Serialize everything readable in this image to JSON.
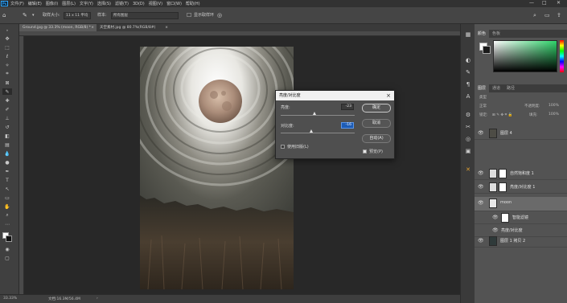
{
  "app": {
    "logo": "Ps"
  },
  "menubar": {
    "items": [
      "文件(F)",
      "编辑(E)",
      "图像(I)",
      "图层(L)",
      "文字(Y)",
      "选择(S)",
      "滤镜(T)",
      "3D(D)",
      "视图(V)",
      "窗口(W)",
      "帮助(H)"
    ],
    "window_controls": {
      "minimize": "—",
      "maximize": "□",
      "close": "✕"
    }
  },
  "options_bar": {
    "tool_icon": "eyedropper-icon",
    "sample_size_label": "取样大小:",
    "sample_size_value": "11 x 11 平均",
    "sample_label": "样本:",
    "sample_value": "所有图层",
    "show_ring_label": "显示取样环",
    "right_icons": [
      "search-icon",
      "workspace-icon",
      "share-icon"
    ]
  },
  "document_tabs": [
    {
      "label": "Ground.jpg @ 33.3% (moon, RGB/8) *",
      "close": "×",
      "active": true
    },
    {
      "label": "天空素材.jpg @ 80.7%(RGB/8#)",
      "close": "×",
      "active": false
    }
  ],
  "statusbar": {
    "zoom": "33.33%",
    "doc_size": "文档:16.3M/56.4M"
  },
  "dialog": {
    "title": "亮度/对比度",
    "close": "×",
    "brightness_label": "亮度:",
    "brightness_value": "-23",
    "brightness_level": 0.46,
    "contrast_label": "对比度:",
    "contrast_value": "-16",
    "contrast_level": 0.42,
    "ok_label": "确定",
    "cancel_label": "取消",
    "auto_label": "自动(A)",
    "legacy_label": "使用旧版(L)",
    "legacy_checked": false,
    "preview_label": "预览(P)",
    "preview_checked": true
  },
  "color_panel": {
    "tabs": [
      "颜色",
      "色板"
    ],
    "foreground": "#ffffff",
    "background": "#1a1a1a"
  },
  "layers_panel": {
    "tabs": [
      "图层",
      "通道",
      "路径"
    ],
    "kind_label": "类型",
    "blend_mode": "正常",
    "opacity_label": "不透明度:",
    "opacity_value": "100%",
    "lock_label": "锁定:",
    "fill_label": "填充:",
    "fill_value": "100%",
    "layers": [
      {
        "name": "图层 4",
        "icon": "eye-icon"
      },
      {
        "name": "自然饱和度 1",
        "icon": "eye-icon"
      },
      {
        "name": "亮度/对比度 1",
        "icon": "eye-icon"
      },
      {
        "name": "moon",
        "icon": "eye-icon",
        "selected": true
      },
      {
        "name": "智能滤镜",
        "icon": "eye-icon"
      },
      {
        "name": "亮度/对比度",
        "icon": "eye-icon"
      },
      {
        "name": "图层 1 拷贝 2",
        "icon": "eye-icon"
      }
    ]
  }
}
